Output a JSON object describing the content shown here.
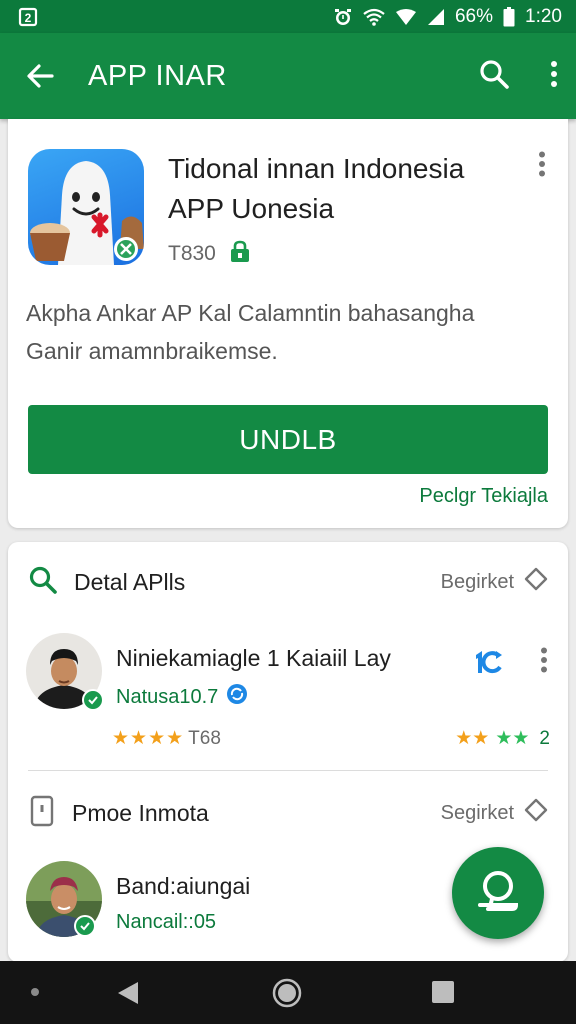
{
  "status_bar": {
    "battery": "66%",
    "time": "1:20"
  },
  "app_bar": {
    "title": "APP INAR"
  },
  "app": {
    "name_line1": "Tidonal innan Indonesia",
    "name_line2": "APP Uonesia",
    "code": "T830",
    "desc_line1": "Akpha Ankar AP Kal Calamntin bahasangha",
    "desc_line2": "Ganir amamnbraikemse.",
    "install_label": "UNDLB",
    "link_label": "Peclgr Tekiajla"
  },
  "section1": {
    "title": "Detal APlls",
    "right_label": "Begirket",
    "review": {
      "name": "Niniekamiagle 1 Kaiaiil Lay",
      "sub": "Natusa10.7",
      "stars_text": "T68",
      "right_badge": "1",
      "right_rating": "2"
    }
  },
  "section2": {
    "title": "Pmoe Inmota",
    "right_label": "Segirket",
    "review": {
      "name": "Band:aiungai",
      "sub": "Nancail::05"
    }
  },
  "colors": {
    "primary": "#138a44",
    "primary_dark": "#0c7a3c",
    "star": "#f3a01b",
    "star_green": "#2ebd5b"
  },
  "icons": {
    "back": "back-arrow-icon",
    "search": "search-icon",
    "more": "more-vert-icon",
    "fab": "chat-icon"
  }
}
